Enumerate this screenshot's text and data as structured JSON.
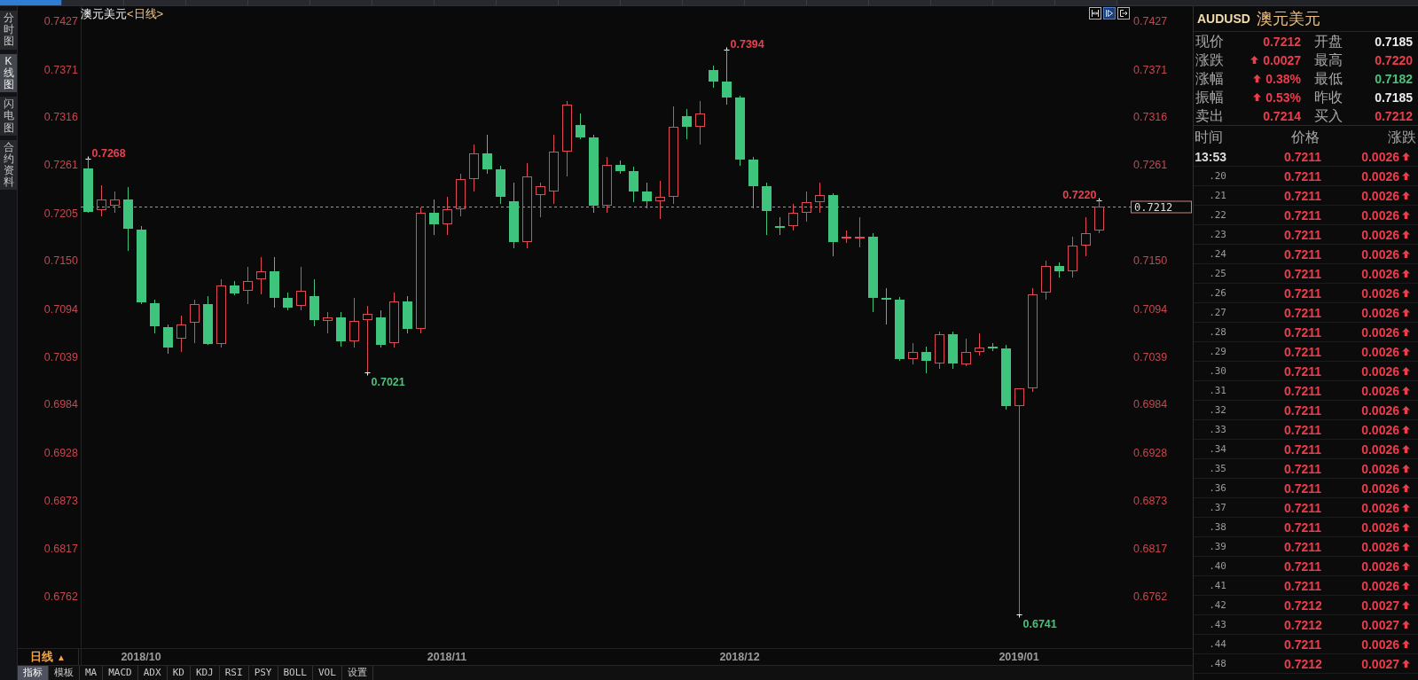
{
  "top_tabs": [
    {
      "selected": true
    },
    {
      "selected": false
    },
    {
      "selected": false
    },
    {
      "selected": false
    },
    {
      "selected": false
    },
    {
      "selected": false
    },
    {
      "selected": false
    },
    {
      "selected": false
    },
    {
      "selected": false
    },
    {
      "selected": false
    },
    {
      "selected": false
    },
    {
      "selected": false
    },
    {
      "selected": false
    },
    {
      "selected": false
    },
    {
      "selected": false
    },
    {
      "selected": false
    },
    {
      "selected": false
    },
    {
      "selected": false
    }
  ],
  "sidebar": {
    "tabs": [
      {
        "label": "分时图",
        "selected": false
      },
      {
        "label": "K线图",
        "selected": true
      },
      {
        "label": "闪电图",
        "selected": false
      },
      {
        "label": "合约资料",
        "selected": false
      }
    ]
  },
  "chart": {
    "symbol": "澳元美元",
    "period": "<日线>",
    "tools": [
      {
        "kind": "fit",
        "selected": false
      },
      {
        "kind": "play",
        "selected": true
      },
      {
        "kind": "exit",
        "selected": false
      }
    ],
    "chart_data": {
      "type": "candlestick",
      "categories": [
        null,
        null,
        null,
        null,
        "2018/10",
        null,
        null,
        null,
        null,
        null,
        null,
        null,
        null,
        null,
        null,
        null,
        null,
        null,
        null,
        null,
        null,
        null,
        null,
        null,
        null,
        null,
        null,
        "2018/11",
        null,
        null,
        null,
        null,
        null,
        null,
        null,
        null,
        null,
        null,
        null,
        null,
        null,
        null,
        null,
        null,
        null,
        null,
        null,
        null,
        null,
        "2018/12",
        null,
        null,
        null,
        null,
        null,
        null,
        null,
        null,
        null,
        null,
        null,
        null,
        null,
        null,
        null,
        null,
        null,
        null,
        null,
        null,
        "2019/01",
        null,
        null,
        null,
        null,
        null,
        null
      ],
      "ohlc": [
        [
          0.7256,
          0.7268,
          0.7205,
          0.7206
        ],
        [
          0.7208,
          0.7237,
          0.7201,
          0.7221
        ],
        [
          0.7213,
          0.723,
          0.7205,
          0.7221
        ],
        [
          0.7221,
          0.7235,
          0.7161,
          0.7187
        ],
        [
          0.7186,
          0.719,
          0.71,
          0.7102
        ],
        [
          0.7101,
          0.7105,
          0.7066,
          0.7074
        ],
        [
          0.7073,
          0.7076,
          0.7042,
          0.7049
        ],
        [
          0.706,
          0.7086,
          0.7044,
          0.7076
        ],
        [
          0.7078,
          0.7105,
          0.7055,
          0.71
        ],
        [
          0.71,
          0.7109,
          0.7052,
          0.7054
        ],
        [
          0.7054,
          0.7128,
          0.7049,
          0.7121
        ],
        [
          0.7121,
          0.7126,
          0.711,
          0.7112
        ],
        [
          0.7115,
          0.7143,
          0.71,
          0.7126
        ],
        [
          0.7128,
          0.7154,
          0.7111,
          0.7138
        ],
        [
          0.7138,
          0.7154,
          0.7096,
          0.7107
        ],
        [
          0.7107,
          0.7113,
          0.7092,
          0.7096
        ],
        [
          0.7098,
          0.7143,
          0.7092,
          0.7115
        ],
        [
          0.7109,
          0.7128,
          0.7074,
          0.7081
        ],
        [
          0.708,
          0.709,
          0.7066,
          0.7084
        ],
        [
          0.7084,
          0.709,
          0.705,
          0.7057
        ],
        [
          0.7057,
          0.7107,
          0.7049,
          0.708
        ],
        [
          0.7081,
          0.7098,
          0.7021,
          0.7088
        ],
        [
          0.7084,
          0.7092,
          0.7049,
          0.7052
        ],
        [
          0.7055,
          0.7113,
          0.7049,
          0.7103
        ],
        [
          0.7103,
          0.7109,
          0.7066,
          0.7071
        ],
        [
          0.7071,
          0.7211,
          0.7066,
          0.7205
        ],
        [
          0.7205,
          0.7221,
          0.718,
          0.7192
        ],
        [
          0.7192,
          0.7224,
          0.718,
          0.7209
        ],
        [
          0.7209,
          0.725,
          0.7201,
          0.7244
        ],
        [
          0.7244,
          0.7284,
          0.723,
          0.7274
        ],
        [
          0.7274,
          0.7295,
          0.725,
          0.7255
        ],
        [
          0.7255,
          0.726,
          0.7215,
          0.7224
        ],
        [
          0.7219,
          0.724,
          0.7164,
          0.7171
        ],
        [
          0.7171,
          0.7263,
          0.7164,
          0.7247
        ],
        [
          0.7226,
          0.724,
          0.72,
          0.7236
        ],
        [
          0.723,
          0.7295,
          0.7215,
          0.7276
        ],
        [
          0.7276,
          0.7334,
          0.7247,
          0.733
        ],
        [
          0.7307,
          0.732,
          0.729,
          0.7292
        ],
        [
          0.7292,
          0.7295,
          0.7205,
          0.7213
        ],
        [
          0.7213,
          0.727,
          0.7205,
          0.7261
        ],
        [
          0.7261,
          0.7266,
          0.725,
          0.7253
        ],
        [
          0.7253,
          0.7258,
          0.7218,
          0.723
        ],
        [
          0.723,
          0.724,
          0.721,
          0.7219
        ],
        [
          0.7219,
          0.7242,
          0.7198,
          0.7224
        ],
        [
          0.7224,
          0.7328,
          0.7215,
          0.7305
        ],
        [
          0.7317,
          0.7325,
          0.729,
          0.7305
        ],
        [
          0.7305,
          0.7334,
          0.7284,
          0.732
        ],
        [
          0.737,
          0.7375,
          0.735,
          0.7357
        ],
        [
          0.7357,
          0.7394,
          0.733,
          0.7338
        ],
        [
          0.7338,
          0.734,
          0.726,
          0.7267
        ],
        [
          0.7267,
          0.727,
          0.721,
          0.7236
        ],
        [
          0.7236,
          0.724,
          0.718,
          0.7207
        ],
        [
          0.719,
          0.72,
          0.718,
          0.7188
        ],
        [
          0.719,
          0.7215,
          0.7185,
          0.7205
        ],
        [
          0.7205,
          0.723,
          0.7195,
          0.7217
        ],
        [
          0.7217,
          0.724,
          0.7205,
          0.7226
        ],
        [
          0.7226,
          0.7228,
          0.7155,
          0.7171
        ],
        [
          0.7176,
          0.7185,
          0.717,
          0.7178
        ],
        [
          0.7177,
          0.72,
          0.7165,
          0.7178
        ],
        [
          0.7178,
          0.7182,
          0.709,
          0.7107
        ],
        [
          0.7107,
          0.7118,
          0.7076,
          0.7105
        ],
        [
          0.7105,
          0.7108,
          0.7034,
          0.7036
        ],
        [
          0.7036,
          0.7055,
          0.703,
          0.7044
        ],
        [
          0.7044,
          0.705,
          0.702,
          0.7034
        ],
        [
          0.7031,
          0.7068,
          0.7025,
          0.7065
        ],
        [
          0.7065,
          0.7068,
          0.7025,
          0.7031
        ],
        [
          0.703,
          0.706,
          0.7028,
          0.7044
        ],
        [
          0.7044,
          0.7066,
          0.704,
          0.7049
        ],
        [
          0.705,
          0.7055,
          0.7045,
          0.7048
        ],
        [
          0.7048,
          0.7052,
          0.6978,
          0.6982
        ],
        [
          0.6982,
          0.7002,
          0.6741,
          0.7002
        ],
        [
          0.7002,
          0.7118,
          0.6998,
          0.7111
        ],
        [
          0.7113,
          0.715,
          0.7105,
          0.7144
        ],
        [
          0.7144,
          0.7148,
          0.713,
          0.7138
        ],
        [
          0.7138,
          0.7178,
          0.713,
          0.7167
        ],
        [
          0.7167,
          0.72,
          0.7155,
          0.7182
        ],
        [
          0.7185,
          0.722,
          0.7182,
          0.7212
        ]
      ],
      "ylim": [
        0.6702,
        0.7444
      ],
      "yticks": [
        {
          "value": 0.7427,
          "label": "0.7427"
        },
        {
          "value": 0.7371,
          "label": "0.7371"
        },
        {
          "value": 0.7316,
          "label": "0.7316"
        },
        {
          "value": 0.7261,
          "label": "0.7261"
        },
        {
          "value": 0.7205,
          "label": "0.7205"
        },
        {
          "value": 0.715,
          "label": "0.7150"
        },
        {
          "value": 0.7094,
          "label": "0.7094"
        },
        {
          "value": 0.7039,
          "label": "0.7039"
        },
        {
          "value": 0.6984,
          "label": "0.6984"
        },
        {
          "value": 0.6928,
          "label": "0.6928"
        },
        {
          "value": 0.6873,
          "label": "0.6873"
        },
        {
          "value": 0.6817,
          "label": "0.6817"
        },
        {
          "value": 0.6762,
          "label": "0.6762"
        }
      ],
      "y2lim": [
        0.6702,
        0.7444
      ],
      "y2ticks": [
        {
          "value": 0.7427,
          "label": "0.7427"
        },
        {
          "value": 0.7371,
          "label": "0.7371"
        },
        {
          "value": 0.7316,
          "label": "0.7316"
        },
        {
          "value": 0.7261,
          "label": "0.7261"
        },
        {
          "value": 0.715,
          "label": "0.7150"
        },
        {
          "value": 0.7094,
          "label": "0.7094"
        },
        {
          "value": 0.7039,
          "label": "0.7039"
        },
        {
          "value": 0.6984,
          "label": "0.6984"
        },
        {
          "value": 0.6928,
          "label": "0.6928"
        },
        {
          "value": 0.6873,
          "label": "0.6873"
        },
        {
          "value": 0.6817,
          "label": "0.6817"
        },
        {
          "value": 0.6762,
          "label": "0.6762"
        }
      ],
      "ref_lines": [
        {
          "axis": "y",
          "value": 0.7212,
          "label": "0.7212"
        }
      ],
      "annotations": [
        "0.7268",
        "0.7021",
        "0.7394",
        "0.6741",
        "0.7220"
      ]
    },
    "period_button": {
      "label": "日线",
      "marker": "▲"
    }
  },
  "indicator_tabs": [
    {
      "label": "指标",
      "selected": true
    },
    {
      "label": "模板",
      "selected": false
    },
    {
      "label": "MA",
      "selected": false
    },
    {
      "label": "MACD",
      "selected": false
    },
    {
      "label": "ADX",
      "selected": false
    },
    {
      "label": "KD",
      "selected": false
    },
    {
      "label": "KDJ",
      "selected": false
    },
    {
      "label": "RSI",
      "selected": false
    },
    {
      "label": "PSY",
      "selected": false
    },
    {
      "label": "BOLL",
      "selected": false
    },
    {
      "label": "VOL",
      "selected": false
    },
    {
      "label": "设置",
      "selected": false
    }
  ],
  "quote": {
    "code": "AUDUSD",
    "name": "澳元美元",
    "fields": [
      {
        "label": "现价",
        "value": "0.7212",
        "color": "#ec3d4d",
        "arrow": false
      },
      {
        "label": "开盘",
        "value": "0.7185",
        "color": "#ececec",
        "arrow": false
      },
      {
        "label": "涨跌",
        "value": "0.0027",
        "color": "#ec3d4d",
        "arrow": true
      },
      {
        "label": "最高",
        "value": "0.7220",
        "color": "#ec3d4d",
        "arrow": false
      },
      {
        "label": "涨幅",
        "value": "0.38%",
        "color": "#ec3d4d",
        "arrow": true
      },
      {
        "label": "最低",
        "value": "0.7182",
        "color": "#4cc07a",
        "arrow": false
      },
      {
        "label": "振幅",
        "value": "0.53%",
        "color": "#ec3d4d",
        "arrow": true
      },
      {
        "label": "昨收",
        "value": "0.7185",
        "color": "#ececec",
        "arrow": false
      },
      {
        "label": "卖出",
        "value": "0.7214",
        "color": "#ec3d4d",
        "arrow": false
      },
      {
        "label": "买入",
        "value": "0.7212",
        "color": "#ec3d4d",
        "arrow": false
      }
    ]
  },
  "ticks": {
    "columns": [
      "时间",
      "价格",
      "涨跌"
    ],
    "rows": [
      {
        "time": "13:53",
        "kind": "minute",
        "price": "0.7211",
        "change": "0.0026",
        "rising": true
      },
      {
        "time": ".20",
        "kind": "second",
        "price": "0.7211",
        "change": "0.0026",
        "rising": true
      },
      {
        "time": ".21",
        "kind": "second",
        "price": "0.7211",
        "change": "0.0026",
        "rising": true
      },
      {
        "time": ".22",
        "kind": "second",
        "price": "0.7211",
        "change": "0.0026",
        "rising": true
      },
      {
        "time": ".23",
        "kind": "second",
        "price": "0.7211",
        "change": "0.0026",
        "rising": true
      },
      {
        "time": ".24",
        "kind": "second",
        "price": "0.7211",
        "change": "0.0026",
        "rising": true
      },
      {
        "time": ".25",
        "kind": "second",
        "price": "0.7211",
        "change": "0.0026",
        "rising": true
      },
      {
        "time": ".26",
        "kind": "second",
        "price": "0.7211",
        "change": "0.0026",
        "rising": true
      },
      {
        "time": ".27",
        "kind": "second",
        "price": "0.7211",
        "change": "0.0026",
        "rising": true
      },
      {
        "time": ".28",
        "kind": "second",
        "price": "0.7211",
        "change": "0.0026",
        "rising": true
      },
      {
        "time": ".29",
        "kind": "second",
        "price": "0.7211",
        "change": "0.0026",
        "rising": true
      },
      {
        "time": ".30",
        "kind": "second",
        "price": "0.7211",
        "change": "0.0026",
        "rising": true
      },
      {
        "time": ".31",
        "kind": "second",
        "price": "0.7211",
        "change": "0.0026",
        "rising": true
      },
      {
        "time": ".32",
        "kind": "second",
        "price": "0.7211",
        "change": "0.0026",
        "rising": true
      },
      {
        "time": ".33",
        "kind": "second",
        "price": "0.7211",
        "change": "0.0026",
        "rising": true
      },
      {
        "time": ".34",
        "kind": "second",
        "price": "0.7211",
        "change": "0.0026",
        "rising": true
      },
      {
        "time": ".35",
        "kind": "second",
        "price": "0.7211",
        "change": "0.0026",
        "rising": true
      },
      {
        "time": ".36",
        "kind": "second",
        "price": "0.7211",
        "change": "0.0026",
        "rising": true
      },
      {
        "time": ".37",
        "kind": "second",
        "price": "0.7211",
        "change": "0.0026",
        "rising": true
      },
      {
        "time": ".38",
        "kind": "second",
        "price": "0.7211",
        "change": "0.0026",
        "rising": true
      },
      {
        "time": ".39",
        "kind": "second",
        "price": "0.7211",
        "change": "0.0026",
        "rising": true
      },
      {
        "time": ".40",
        "kind": "second",
        "price": "0.7211",
        "change": "0.0026",
        "rising": true
      },
      {
        "time": ".41",
        "kind": "second",
        "price": "0.7211",
        "change": "0.0026",
        "rising": true
      },
      {
        "time": ".42",
        "kind": "second",
        "price": "0.7212",
        "change": "0.0027",
        "rising": true
      },
      {
        "time": ".43",
        "kind": "second",
        "price": "0.7212",
        "change": "0.0027",
        "rising": true
      },
      {
        "time": ".44",
        "kind": "second",
        "price": "0.7211",
        "change": "0.0026",
        "rising": true
      },
      {
        "time": ".48",
        "kind": "second",
        "price": "0.7212",
        "change": "0.0027",
        "rising": true
      }
    ]
  }
}
